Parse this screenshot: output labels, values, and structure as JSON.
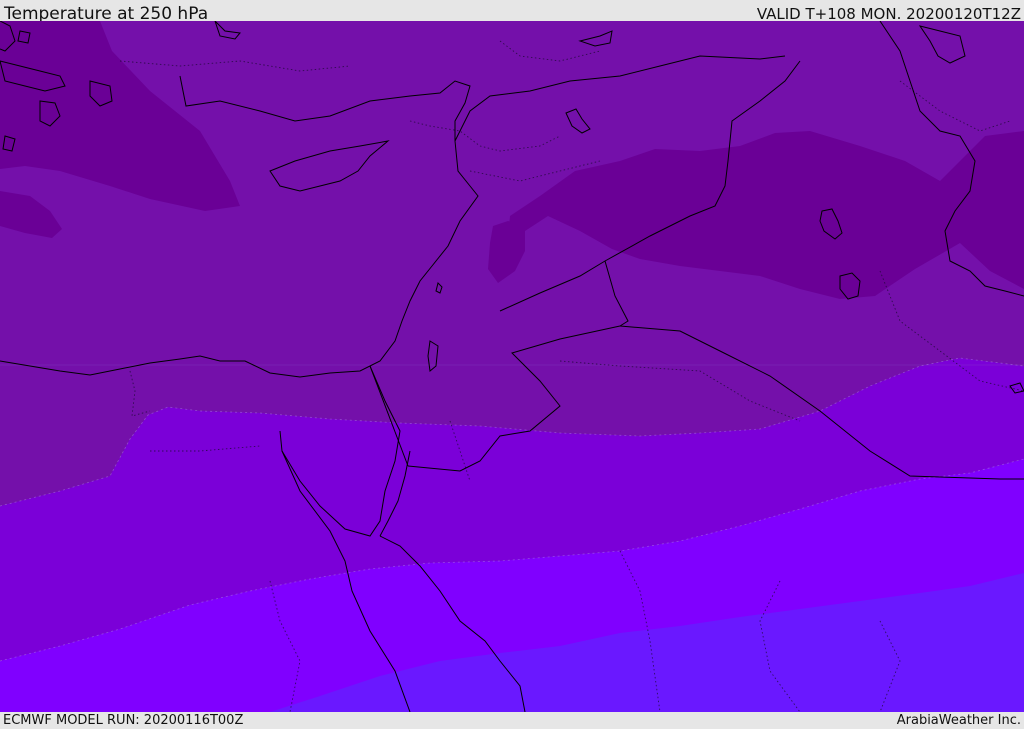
{
  "header": {
    "title": "Temperature at 250 hPa",
    "valid": "VALID T+108 MON. 20200120T12Z"
  },
  "footer": {
    "model_run": "ECMWF MODEL RUN: 20200116T00Z",
    "brand": "ArabiaWeather Inc."
  },
  "map": {
    "field": "temperature",
    "level": "250 hPa",
    "region": "Eastern Mediterranean / Middle East",
    "colors": {
      "coldest": "#6a0096",
      "cold": "#7410aa",
      "mid": "#7b00d8",
      "warm": "#8000ff",
      "warmest": "#6a18ff",
      "coastline": "#000000",
      "contour": "#b59be0"
    }
  }
}
